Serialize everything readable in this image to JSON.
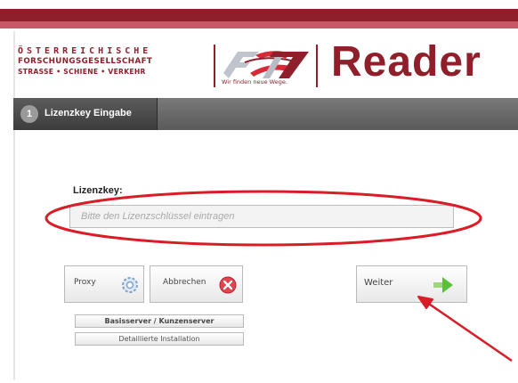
{
  "header": {
    "org_line1": "ÖSTERREICHISCHE",
    "org_line2": "FORSCHUNGSGESELLSCHAFT",
    "org_line3": "STRASSE • SCHIENE • VERKEHR",
    "slogan": "Wir finden neue Wege.",
    "app_title": "Reader",
    "brand_color": "#8f1f2b"
  },
  "tabs": [
    {
      "number": "1",
      "label": "Lizenzkey Eingabe"
    }
  ],
  "form": {
    "license_label": "Lizenzkey:",
    "license_placeholder": "Bitte den Lizenzschlüssel eintragen",
    "license_value": ""
  },
  "buttons": {
    "proxy": "Proxy",
    "cancel": "Abbrechen",
    "next": "Weiter",
    "base_client_server": "Basisserver / Kunzenserver",
    "detailed_install": "Detaillierte Installation"
  },
  "annotation": {
    "highlight_color": "#d91c26"
  }
}
